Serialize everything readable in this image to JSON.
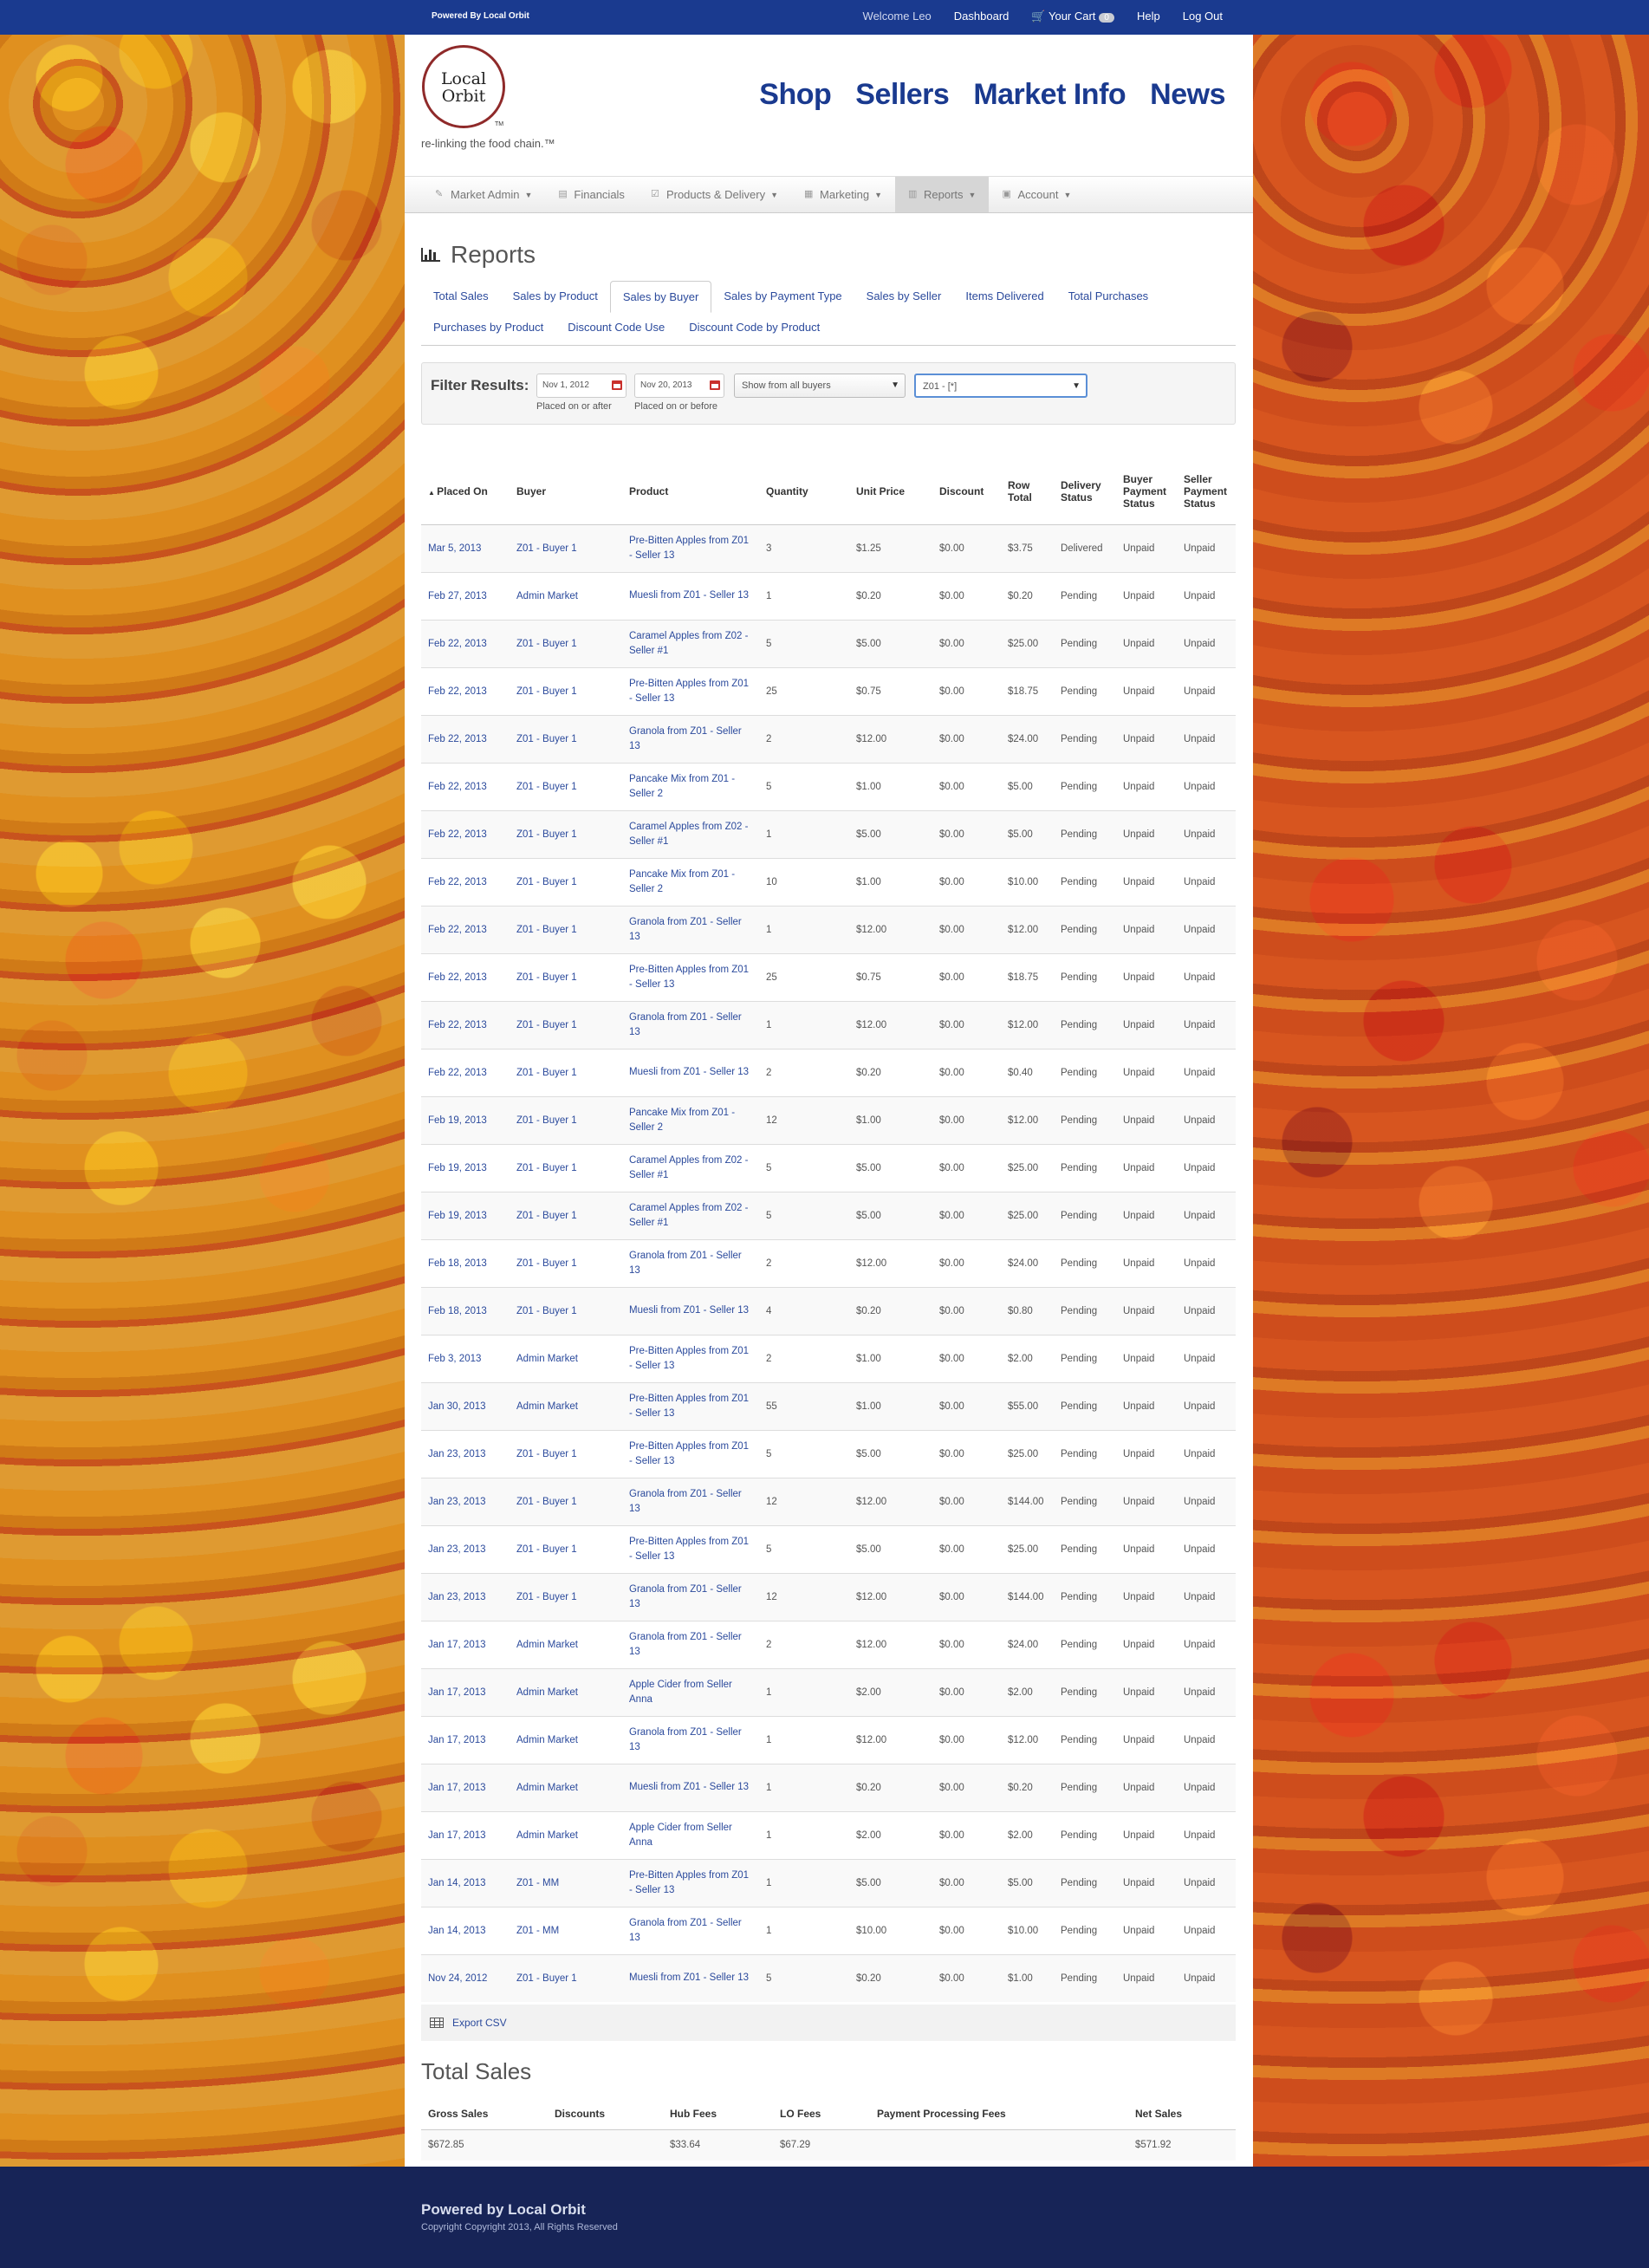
{
  "topbar": {
    "powered": "Powered By Local Orbit",
    "welcome": "Welcome Leo",
    "dashboard": "Dashboard",
    "cart": "Your Cart",
    "cart_count": "0",
    "help": "Help",
    "logout": "Log Out"
  },
  "logo": {
    "line1": "Local",
    "line2": "Orbit",
    "tm": "TM",
    "tagline": "re-linking the food chain.™"
  },
  "mainnav": [
    "Shop",
    "Sellers",
    "Market Info",
    "News"
  ],
  "subnav": [
    {
      "label": "Market Admin",
      "icon": "wrench-icon",
      "caret": true
    },
    {
      "label": "Financials",
      "icon": "money-icon",
      "caret": false
    },
    {
      "label": "Products & Delivery",
      "icon": "check-icon",
      "caret": true
    },
    {
      "label": "Marketing",
      "icon": "grid-icon",
      "caret": true
    },
    {
      "label": "Reports",
      "icon": "chart-icon",
      "caret": true,
      "active": true
    },
    {
      "label": "Account",
      "icon": "user-icon",
      "caret": true
    }
  ],
  "page": {
    "title": "Reports"
  },
  "tabs": {
    "row1": [
      "Total Sales",
      "Sales by Product",
      "Sales by Buyer",
      "Sales by Payment Type",
      "Sales by Seller",
      "Items Delivered",
      "Total Purchases"
    ],
    "row2": [
      "Purchases by Product",
      "Discount Code Use",
      "Discount Code by Product"
    ],
    "active": "Sales by Buyer"
  },
  "filter": {
    "label": "Filter Results:",
    "start_date": "Nov 1, 2012",
    "start_help": "Placed on or after",
    "end_date": "Nov 20, 2013",
    "end_help": "Placed on or before",
    "buyer_select": "Show from all buyers",
    "market_select": "Z01 - [*]"
  },
  "table": {
    "headers": [
      "Placed On",
      "Buyer",
      "Product",
      "Quantity",
      "Unit Price",
      "Discount",
      "Row Total",
      "Delivery Status",
      "Buyer Payment Status",
      "Seller Payment Status"
    ],
    "rows": [
      [
        "Mar 5, 2013",
        "Z01 - Buyer 1",
        "Pre-Bitten Apples from Z01 - Seller 13",
        "3",
        "$1.25",
        "$0.00",
        "$3.75",
        "Delivered",
        "Unpaid",
        "Unpaid"
      ],
      [
        "Feb 27, 2013",
        "Admin Market",
        "Muesli from Z01 - Seller 13",
        "1",
        "$0.20",
        "$0.00",
        "$0.20",
        "Pending",
        "Unpaid",
        "Unpaid"
      ],
      [
        "Feb 22, 2013",
        "Z01 - Buyer 1",
        "Caramel Apples from Z02 - Seller #1",
        "5",
        "$5.00",
        "$0.00",
        "$25.00",
        "Pending",
        "Unpaid",
        "Unpaid"
      ],
      [
        "Feb 22, 2013",
        "Z01 - Buyer 1",
        "Pre-Bitten Apples from Z01 - Seller 13",
        "25",
        "$0.75",
        "$0.00",
        "$18.75",
        "Pending",
        "Unpaid",
        "Unpaid"
      ],
      [
        "Feb 22, 2013",
        "Z01 - Buyer 1",
        "Granola from Z01 - Seller 13",
        "2",
        "$12.00",
        "$0.00",
        "$24.00",
        "Pending",
        "Unpaid",
        "Unpaid"
      ],
      [
        "Feb 22, 2013",
        "Z01 - Buyer 1",
        "Pancake Mix from Z01 - Seller 2",
        "5",
        "$1.00",
        "$0.00",
        "$5.00",
        "Pending",
        "Unpaid",
        "Unpaid"
      ],
      [
        "Feb 22, 2013",
        "Z01 - Buyer 1",
        "Caramel Apples from Z02 - Seller #1",
        "1",
        "$5.00",
        "$0.00",
        "$5.00",
        "Pending",
        "Unpaid",
        "Unpaid"
      ],
      [
        "Feb 22, 2013",
        "Z01 - Buyer 1",
        "Pancake Mix from Z01 - Seller 2",
        "10",
        "$1.00",
        "$0.00",
        "$10.00",
        "Pending",
        "Unpaid",
        "Unpaid"
      ],
      [
        "Feb 22, 2013",
        "Z01 - Buyer 1",
        "Granola from Z01 - Seller 13",
        "1",
        "$12.00",
        "$0.00",
        "$12.00",
        "Pending",
        "Unpaid",
        "Unpaid"
      ],
      [
        "Feb 22, 2013",
        "Z01 - Buyer 1",
        "Pre-Bitten Apples from Z01 - Seller 13",
        "25",
        "$0.75",
        "$0.00",
        "$18.75",
        "Pending",
        "Unpaid",
        "Unpaid"
      ],
      [
        "Feb 22, 2013",
        "Z01 - Buyer 1",
        "Granola from Z01 - Seller 13",
        "1",
        "$12.00",
        "$0.00",
        "$12.00",
        "Pending",
        "Unpaid",
        "Unpaid"
      ],
      [
        "Feb 22, 2013",
        "Z01 - Buyer 1",
        "Muesli from Z01 - Seller 13",
        "2",
        "$0.20",
        "$0.00",
        "$0.40",
        "Pending",
        "Unpaid",
        "Unpaid"
      ],
      [
        "Feb 19, 2013",
        "Z01 - Buyer 1",
        "Pancake Mix from Z01 - Seller 2",
        "12",
        "$1.00",
        "$0.00",
        "$12.00",
        "Pending",
        "Unpaid",
        "Unpaid"
      ],
      [
        "Feb 19, 2013",
        "Z01 - Buyer 1",
        "Caramel Apples from Z02 - Seller #1",
        "5",
        "$5.00",
        "$0.00",
        "$25.00",
        "Pending",
        "Unpaid",
        "Unpaid"
      ],
      [
        "Feb 19, 2013",
        "Z01 - Buyer 1",
        "Caramel Apples from Z02 - Seller #1",
        "5",
        "$5.00",
        "$0.00",
        "$25.00",
        "Pending",
        "Unpaid",
        "Unpaid"
      ],
      [
        "Feb 18, 2013",
        "Z01 - Buyer 1",
        "Granola from Z01 - Seller 13",
        "2",
        "$12.00",
        "$0.00",
        "$24.00",
        "Pending",
        "Unpaid",
        "Unpaid"
      ],
      [
        "Feb 18, 2013",
        "Z01 - Buyer 1",
        "Muesli from Z01 - Seller 13",
        "4",
        "$0.20",
        "$0.00",
        "$0.80",
        "Pending",
        "Unpaid",
        "Unpaid"
      ],
      [
        "Feb 3, 2013",
        "Admin Market",
        "Pre-Bitten Apples from Z01 - Seller 13",
        "2",
        "$1.00",
        "$0.00",
        "$2.00",
        "Pending",
        "Unpaid",
        "Unpaid"
      ],
      [
        "Jan 30, 2013",
        "Admin Market",
        "Pre-Bitten Apples from Z01 - Seller 13",
        "55",
        "$1.00",
        "$0.00",
        "$55.00",
        "Pending",
        "Unpaid",
        "Unpaid"
      ],
      [
        "Jan 23, 2013",
        "Z01 - Buyer 1",
        "Pre-Bitten Apples from Z01 - Seller 13",
        "5",
        "$5.00",
        "$0.00",
        "$25.00",
        "Pending",
        "Unpaid",
        "Unpaid"
      ],
      [
        "Jan 23, 2013",
        "Z01 - Buyer 1",
        "Granola from Z01 - Seller 13",
        "12",
        "$12.00",
        "$0.00",
        "$144.00",
        "Pending",
        "Unpaid",
        "Unpaid"
      ],
      [
        "Jan 23, 2013",
        "Z01 - Buyer 1",
        "Pre-Bitten Apples from Z01 - Seller 13",
        "5",
        "$5.00",
        "$0.00",
        "$25.00",
        "Pending",
        "Unpaid",
        "Unpaid"
      ],
      [
        "Jan 23, 2013",
        "Z01 - Buyer 1",
        "Granola from Z01 - Seller 13",
        "12",
        "$12.00",
        "$0.00",
        "$144.00",
        "Pending",
        "Unpaid",
        "Unpaid"
      ],
      [
        "Jan 17, 2013",
        "Admin Market",
        "Granola from Z01 - Seller 13",
        "2",
        "$12.00",
        "$0.00",
        "$24.00",
        "Pending",
        "Unpaid",
        "Unpaid"
      ],
      [
        "Jan 17, 2013",
        "Admin Market",
        "Apple Cider from Seller Anna",
        "1",
        "$2.00",
        "$0.00",
        "$2.00",
        "Pending",
        "Unpaid",
        "Unpaid"
      ],
      [
        "Jan 17, 2013",
        "Admin Market",
        "Granola from Z01 - Seller 13",
        "1",
        "$12.00",
        "$0.00",
        "$12.00",
        "Pending",
        "Unpaid",
        "Unpaid"
      ],
      [
        "Jan 17, 2013",
        "Admin Market",
        "Muesli from Z01 - Seller 13",
        "1",
        "$0.20",
        "$0.00",
        "$0.20",
        "Pending",
        "Unpaid",
        "Unpaid"
      ],
      [
        "Jan 17, 2013",
        "Admin Market",
        "Apple Cider from Seller Anna",
        "1",
        "$2.00",
        "$0.00",
        "$2.00",
        "Pending",
        "Unpaid",
        "Unpaid"
      ],
      [
        "Jan 14, 2013",
        "Z01 - MM",
        "Pre-Bitten Apples from Z01 - Seller 13",
        "1",
        "$5.00",
        "$0.00",
        "$5.00",
        "Pending",
        "Unpaid",
        "Unpaid"
      ],
      [
        "Jan 14, 2013",
        "Z01 - MM",
        "Granola from Z01 - Seller 13",
        "1",
        "$10.00",
        "$0.00",
        "$10.00",
        "Pending",
        "Unpaid",
        "Unpaid"
      ],
      [
        "Nov 24, 2012",
        "Z01 - Buyer 1",
        "Muesli from Z01 - Seller 13",
        "5",
        "$0.20",
        "$0.00",
        "$1.00",
        "Pending",
        "Unpaid",
        "Unpaid"
      ]
    ]
  },
  "export": {
    "label": "Export CSV"
  },
  "totals": {
    "title": "Total Sales",
    "headers": [
      "Gross Sales",
      "Discounts",
      "Hub Fees",
      "LO Fees",
      "Payment Processing Fees",
      "Net Sales"
    ],
    "values": [
      "$672.85",
      "",
      "$33.64",
      "$67.29",
      "",
      "$571.92"
    ]
  },
  "footer": {
    "powered": "Powered by Local Orbit",
    "copyright": "Copyright Copyright 2013, All Rights Reserved"
  },
  "colors": {
    "topbar": "#1a3a8f",
    "footer": "#172457",
    "link": "#2b4a9c"
  }
}
